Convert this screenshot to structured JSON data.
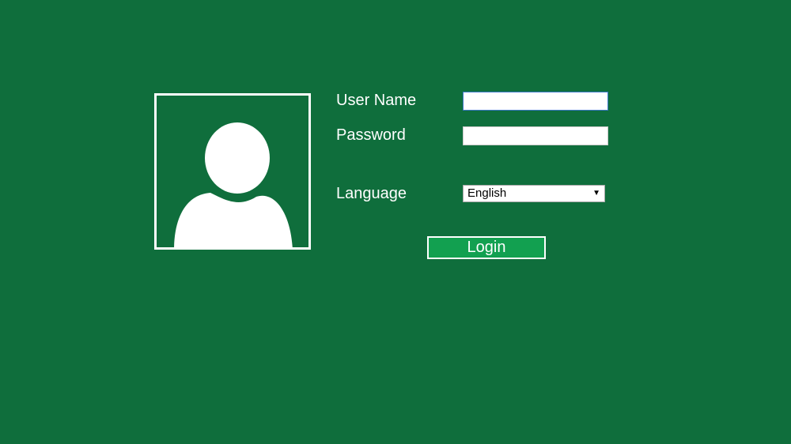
{
  "theme": {
    "background": "#0f6e3c",
    "button_fill": "#12a050",
    "foreground": "#ffffff"
  },
  "avatar": {
    "icon": "user-silhouette-icon"
  },
  "form": {
    "username_label": "User Name",
    "username_value": "",
    "password_label": "Password",
    "password_value": "",
    "language_label": "Language",
    "language_selected": "English",
    "login_label": "Login"
  }
}
